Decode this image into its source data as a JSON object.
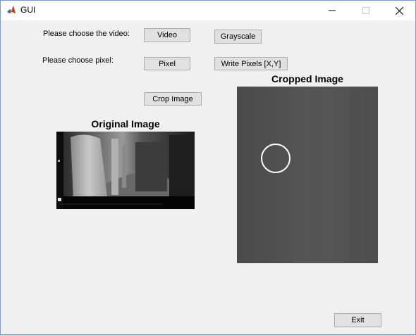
{
  "window": {
    "title": "GUI",
    "icon": "matlab-icon"
  },
  "labels": {
    "choose_video": "Please choose the video:",
    "choose_pixel": "Please choose pixel:"
  },
  "buttons": {
    "video": "Video",
    "grayscale": "Grayscale",
    "pixel": "Pixel",
    "write_pixels": "Write Pixels [X,Y]",
    "crop_image": "Crop Image",
    "exit": "Exit"
  },
  "panels": {
    "original_title": "Original Image",
    "cropped_title": "Cropped Image"
  },
  "colors": {
    "window_bg": "#f0f0f0",
    "button_bg": "#e1e1e1",
    "button_border": "#adadad",
    "cropped_bg": "#535353"
  }
}
